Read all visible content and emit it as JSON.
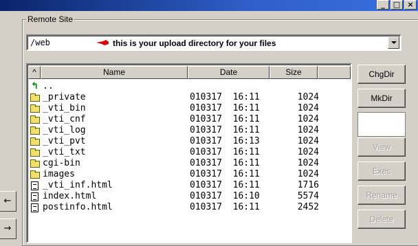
{
  "group_label": "Remote Site",
  "path": {
    "value": "/web",
    "hint": "this is your upload directory for your files",
    "hint_color": "#e00000"
  },
  "columns": {
    "sort": "^",
    "name": "Name",
    "date": "Date",
    "size": "Size"
  },
  "files": [
    {
      "icon": "up-folder-icon",
      "name": "..",
      "date": "",
      "size": ""
    },
    {
      "icon": "folder-icon",
      "name": "_private",
      "date": "010317  16:11",
      "size": "1024"
    },
    {
      "icon": "folder-icon",
      "name": "_vti_bin",
      "date": "010317  16:11",
      "size": "1024"
    },
    {
      "icon": "folder-icon",
      "name": "_vti_cnf",
      "date": "010317  16:11",
      "size": "1024"
    },
    {
      "icon": "folder-icon",
      "name": "_vti_log",
      "date": "010317  16:11",
      "size": "1024"
    },
    {
      "icon": "folder-icon",
      "name": "_vti_pvt",
      "date": "010317  16:13",
      "size": "1024"
    },
    {
      "icon": "folder-icon",
      "name": "_vti_txt",
      "date": "010317  16:11",
      "size": "1024"
    },
    {
      "icon": "folder-icon",
      "name": "cgi-bin",
      "date": "010317  16:11",
      "size": "1024"
    },
    {
      "icon": "folder-icon",
      "name": "images",
      "date": "010317  16:11",
      "size": "1024"
    },
    {
      "icon": "file-icon",
      "name": "_vti_inf.html",
      "date": "010317  16:11",
      "size": "1716"
    },
    {
      "icon": "file-icon",
      "name": "index.html",
      "date": "010317  16:10",
      "size": "5574"
    },
    {
      "icon": "file-icon",
      "name": "postinfo.html",
      "date": "010317  16:11",
      "size": "2452"
    }
  ],
  "buttons": {
    "chgdir": "ChgDir",
    "mkdir": "MkDir",
    "view": "View",
    "exec": "Exec",
    "rename": "Rename",
    "delete": "Delete"
  },
  "nav": {
    "back": "←",
    "forward": "→"
  },
  "window_buttons": {
    "minimize": "_",
    "maximize": "□",
    "close": "×"
  }
}
